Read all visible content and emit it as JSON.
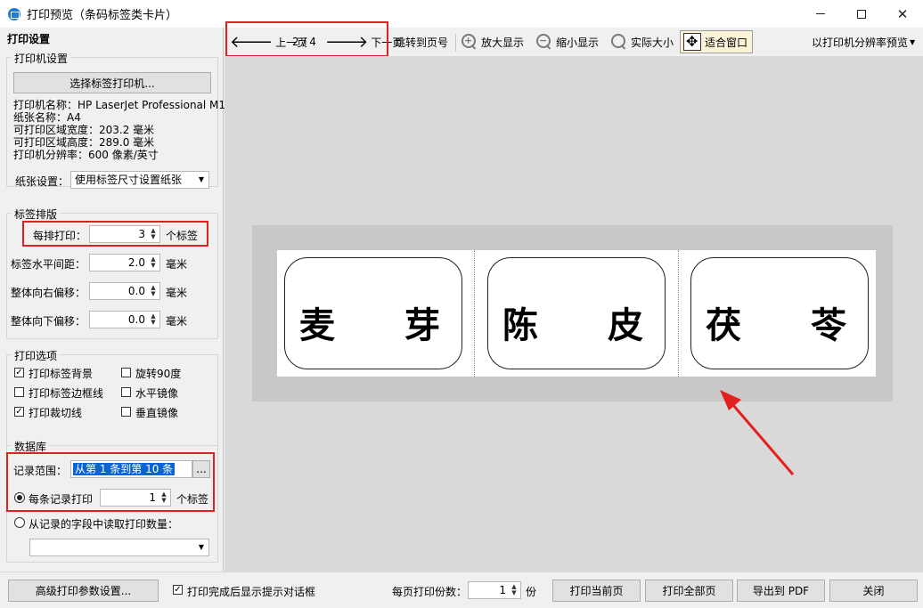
{
  "window": {
    "title": "打印预览（条码标签类卡片）",
    "minimize": "—",
    "maximize": "□",
    "close": "✕"
  },
  "left_panel": {
    "header": "打印设置",
    "printer_group": {
      "title": "打印机设置",
      "select_button": "选择标签打印机...",
      "info": [
        "打印机名称：HP LaserJet Professional M1",
        "纸张名称：A4",
        "可打印区域宽度：203.2 毫米",
        "可打印区域高度：289.0 毫米",
        "打印机分辨率：600 像素/英寸"
      ],
      "paper_label": "纸张设置：",
      "paper_value": "使用标签尺寸设置纸张"
    },
    "layout_group": {
      "title": "标签排版",
      "per_row_label": "每排打印：",
      "per_row_value": "3",
      "per_row_unit": "个标签",
      "hgap_label": "标签水平间距：",
      "hgap_value": "2.0",
      "hgap_unit": "毫米",
      "right_offset_label": "整体向右偏移：",
      "right_offset_value": "0.0",
      "right_offset_unit": "毫米",
      "down_offset_label": "整体向下偏移：",
      "down_offset_value": "0.0",
      "down_offset_unit": "毫米"
    },
    "options_group": {
      "title": "打印选项",
      "options": [
        {
          "label": "打印标签背景",
          "checked": true
        },
        {
          "label": "旋转90度",
          "checked": false
        },
        {
          "label": "打印标签边框线",
          "checked": false
        },
        {
          "label": "水平镜像",
          "checked": false
        },
        {
          "label": "打印裁切线",
          "checked": true
        },
        {
          "label": "垂直镜像",
          "checked": false
        }
      ]
    },
    "database_group": {
      "title": "数据库",
      "range_label": "记录范围：",
      "range_value": "从第 1 条到第 10 条",
      "range_button": "...",
      "per_record_label": "每条记录打印",
      "per_record_value": "1",
      "per_record_unit": "个标签",
      "from_field_label": "从记录的字段中读取打印数量："
    }
  },
  "toolbar": {
    "prev_label": "上一页",
    "page_indicator": "2 / 4",
    "next_label": "下一页",
    "goto_label": "跳转到页号",
    "zoom_in_label": "放大显示",
    "zoom_out_label": "缩小显示",
    "actual_size_label": "实际大小",
    "fit_window_label": "适合窗口",
    "resolution_preview_label": "以打印机分辨率预览"
  },
  "preview": {
    "labels": [
      {
        "left": "麦",
        "right": "芽"
      },
      {
        "left": "陈",
        "right": "皮"
      },
      {
        "left": "茯",
        "right": "苓"
      }
    ]
  },
  "bottom_bar": {
    "advanced_button": "高级打印参数设置...",
    "show_dialog_label": "打印完成后显示提示对话框",
    "show_dialog_checked": true,
    "copies_label": "每页打印份数：",
    "copies_value": "1",
    "copies_unit": "份",
    "print_current_button": "打印当前页",
    "print_all_button": "打印全部页",
    "export_pdf_button": "导出到 PDF",
    "close_button": "关闭"
  },
  "colors": {
    "highlight_red": "#e32020",
    "selection_blue": "#0a64d8",
    "fit_active_bg": "#fbf3d8"
  }
}
